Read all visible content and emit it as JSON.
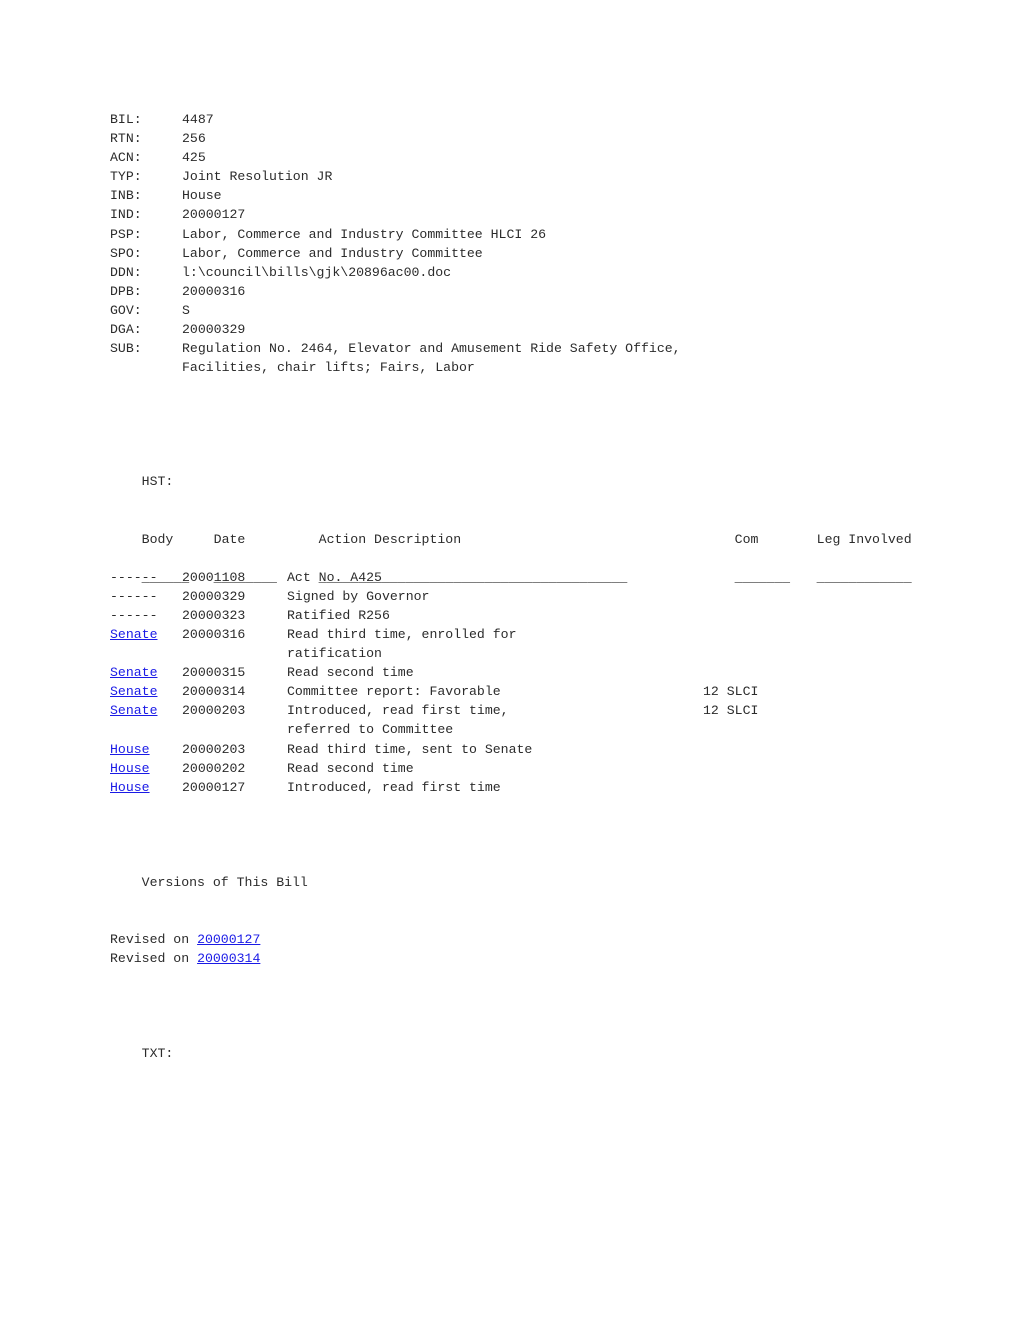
{
  "header_fields": [
    {
      "label": "BIL:",
      "value": "4487"
    },
    {
      "label": "RTN:",
      "value": "256"
    },
    {
      "label": "ACN:",
      "value": "425"
    },
    {
      "label": "TYP:",
      "value": "Joint Resolution JR"
    },
    {
      "label": "INB:",
      "value": "House"
    },
    {
      "label": "IND:",
      "value": "20000127"
    },
    {
      "label": "PSP:",
      "value": "Labor, Commerce and Industry Committee HLCI 26"
    },
    {
      "label": "SPO:",
      "value": "Labor, Commerce and Industry Committee"
    },
    {
      "label": "DDN:",
      "value": "l:\\council\\bills\\gjk\\20896ac00.doc"
    },
    {
      "label": "DPB:",
      "value": "20000316"
    },
    {
      "label": "GOV:",
      "value": "S"
    },
    {
      "label": "DGA:",
      "value": "20000329"
    },
    {
      "label": "SUB:",
      "value": "Regulation No. 2464, Elevator and Amusement Ride Safety Office,",
      "value_line2": "Facilities, chair lifts; Fairs, Labor"
    }
  ],
  "history": {
    "section_label": "HST:",
    "columns": {
      "body": "Body",
      "date": "Date",
      "action": "Action Description",
      "com": "Com",
      "leg": "Leg Involved"
    },
    "separators": {
      "body": "______",
      "date": "________",
      "action": "_______________________________________",
      "com": "_______",
      "leg": "____________"
    },
    "rows": [
      {
        "body": "------",
        "body_link": false,
        "date": "20001108",
        "action": "Act No. A425",
        "action_line2": "",
        "com": "",
        "leg": ""
      },
      {
        "body": "------",
        "body_link": false,
        "date": "20000329",
        "action": "Signed by Governor",
        "action_line2": "",
        "com": "",
        "leg": ""
      },
      {
        "body": "------",
        "body_link": false,
        "date": "20000323",
        "action": "Ratified R256",
        "action_line2": "",
        "com": "",
        "leg": ""
      },
      {
        "body": "Senate",
        "body_link": true,
        "date": "20000316",
        "action": "Read third time, enrolled for",
        "action_line2": "ratification",
        "com": "",
        "leg": ""
      },
      {
        "body": "Senate",
        "body_link": true,
        "date": "20000315",
        "action": "Read second time",
        "action_line2": "",
        "com": "",
        "leg": ""
      },
      {
        "body": "Senate",
        "body_link": true,
        "date": "20000314",
        "action": "Committee report: Favorable",
        "action_line2": "",
        "com": "12 SLCI",
        "leg": ""
      },
      {
        "body": "Senate",
        "body_link": true,
        "date": "20000203",
        "action": "Introduced, read first time,",
        "action_line2": "referred to Committee",
        "com": "12 SLCI",
        "leg": ""
      },
      {
        "body": "House",
        "body_link": true,
        "date": "20000203",
        "action": "Read third time, sent to Senate",
        "action_line2": "",
        "com": "",
        "leg": ""
      },
      {
        "body": "House",
        "body_link": true,
        "date": "20000202",
        "action": "Read second time",
        "action_line2": "",
        "com": "",
        "leg": ""
      },
      {
        "body": "House",
        "body_link": true,
        "date": "20000127",
        "action": "Introduced, read first time",
        "action_line2": "",
        "com": "",
        "leg": ""
      }
    ]
  },
  "versions": {
    "heading": "Versions of This Bill",
    "entries": [
      {
        "prefix": "Revised on ",
        "date": "20000127"
      },
      {
        "prefix": "Revised on ",
        "date": "20000314"
      }
    ]
  },
  "text_section": {
    "label": "TXT:"
  },
  "colors": {
    "link": "#1a1ae6",
    "text": "#2b2b2b",
    "background": "#ffffff"
  }
}
